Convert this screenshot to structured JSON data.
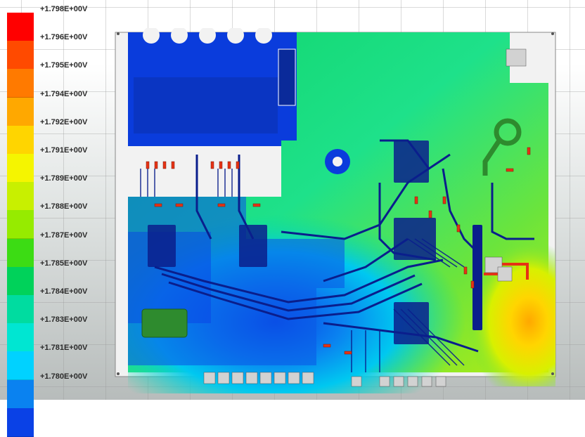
{
  "legend": {
    "labels": [
      "+1.798E+00V",
      "+1.796E+00V",
      "+1.795E+00V",
      "+1.794E+00V",
      "+1.792E+00V",
      "+1.791E+00V",
      "+1.789E+00V",
      "+1.788E+00V",
      "+1.787E+00V",
      "+1.785E+00V",
      "+1.784E+00V",
      "+1.783E+00V",
      "+1.781E+00V",
      "+1.780E+00V"
    ],
    "colors": [
      "#ff0000",
      "#ff4a00",
      "#ff7a00",
      "#ffa800",
      "#ffd500",
      "#f5f500",
      "#c8f000",
      "#96eb00",
      "#3cdc14",
      "#00d25a",
      "#00dca0",
      "#00e6d2",
      "#00d2ff",
      "#0a82f0",
      "#0a41e6"
    ]
  },
  "board": {
    "colors": {
      "blue": "#0a3cdc",
      "green": "#1ee17a",
      "yellow": "#f8f000",
      "cyan": "#28e6d2",
      "trace": "#0a1e8c",
      "pad": "#d2d2d2",
      "copper_red": "#e63214",
      "via_green": "#2e8b2e"
    }
  }
}
